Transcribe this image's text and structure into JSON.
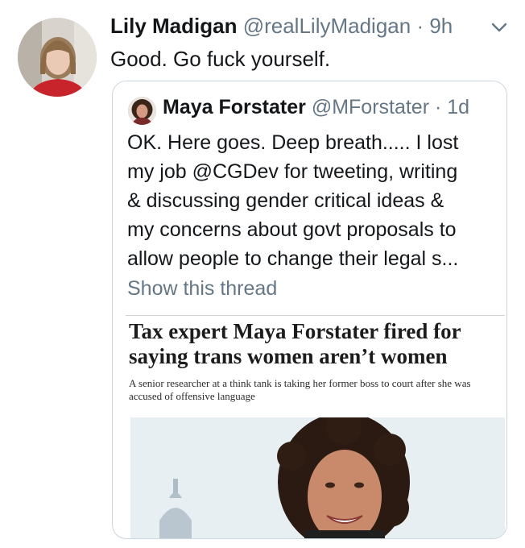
{
  "tweet": {
    "author_name": "Lily Madigan",
    "author_handle": "@realLilyMadigan",
    "time": "· 9h",
    "text": "Good. Go fuck yourself."
  },
  "quoted_tweet": {
    "author_name": "Maya Forstater",
    "author_handle": "@MForstater",
    "time": "· 1d",
    "text_lines": [
      "OK. Here goes. Deep breath..... I lost",
      "my job @CGDev for tweeting, writing",
      "& discussing gender critical ideas &",
      "my concerns about govt proposals to",
      "allow people to change their legal s..."
    ],
    "show_thread": "Show this thread"
  },
  "article": {
    "headline": "Tax expert Maya Forstater fired for saying trans women aren’t women",
    "standfirst": "A senior researcher at a think tank is taking her former boss to court after she was accused of offensive language"
  },
  "icons": {
    "menu": "chevron-down-icon",
    "avatar": "profile-photo",
    "quoted_avatar": "profile-photo",
    "article_photo": "portrait-with-dome-background"
  },
  "colors": {
    "text": "#14171a",
    "secondary": "#657786",
    "border": "#ccd6dd"
  }
}
